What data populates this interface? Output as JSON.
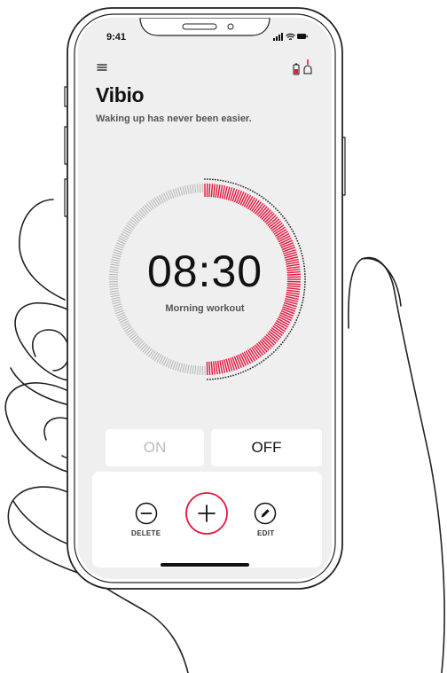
{
  "status_bar": {
    "time": "9:41"
  },
  "header": {
    "title": "Vibio",
    "subtitle": "Waking up has never been easier."
  },
  "alarm": {
    "time": "08:30",
    "label": "Morning workout",
    "ring_progress": 0.5
  },
  "toggle": {
    "on_label": "ON",
    "off_label": "OFF",
    "selected": "OFF"
  },
  "actions": {
    "delete_label": "DELETE",
    "edit_label": "EDIT"
  },
  "colors": {
    "accent": "#e5173f",
    "screen_background": "#efefef",
    "panel_background": "#ffffff",
    "inactive_ticks": "#b5b5b5",
    "dark_ticks": "#222222",
    "inactive_text": "#bbbbbb"
  },
  "icons": [
    "menu-icon",
    "battery-alarm-icon",
    "bell-icon",
    "minus-circle-icon",
    "plus-circle-icon",
    "pencil-icon",
    "signal-icon",
    "wifi-icon",
    "battery-icon"
  ]
}
